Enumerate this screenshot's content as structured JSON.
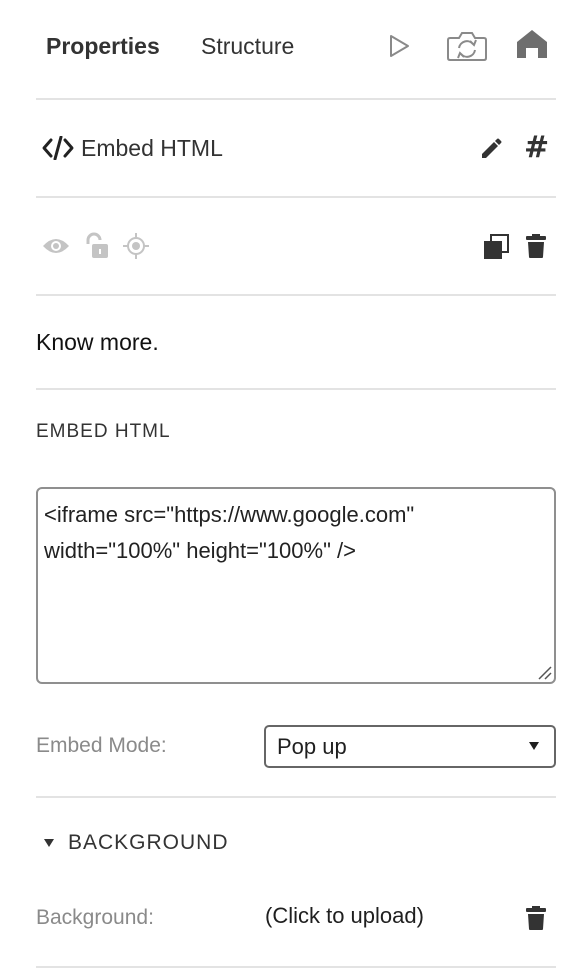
{
  "tabs": [
    {
      "label": "Properties",
      "active": true
    },
    {
      "label": "Structure",
      "active": false
    }
  ],
  "toolbar_icons": [
    "play-icon",
    "refresh-camera-icon",
    "home-icon"
  ],
  "element": {
    "title": "Embed HTML",
    "icon": "code-icon",
    "actions": [
      "pencil-icon",
      "hash-icon"
    ],
    "hash_symbol": "#"
  },
  "state_icons": [
    "eye-icon",
    "unlock-icon",
    "crosshair-icon",
    "copy-icon",
    "trash-icon"
  ],
  "description": "Know more.",
  "embed_section": {
    "title": "EMBED HTML",
    "code": "<iframe src=\"https://www.google.com\" width=\"100%\" height=\"100%\" />"
  },
  "embed_mode": {
    "label": "Embed Mode:",
    "value": "Pop up"
  },
  "background_section": {
    "title": "BACKGROUND",
    "label": "Background:",
    "upload_text": "(Click to upload)"
  },
  "colors": {
    "text": "#333333",
    "muted_label": "#8a8a8a",
    "disabled_icon": "#c4c4c4",
    "divider": "#e3e3e3"
  }
}
